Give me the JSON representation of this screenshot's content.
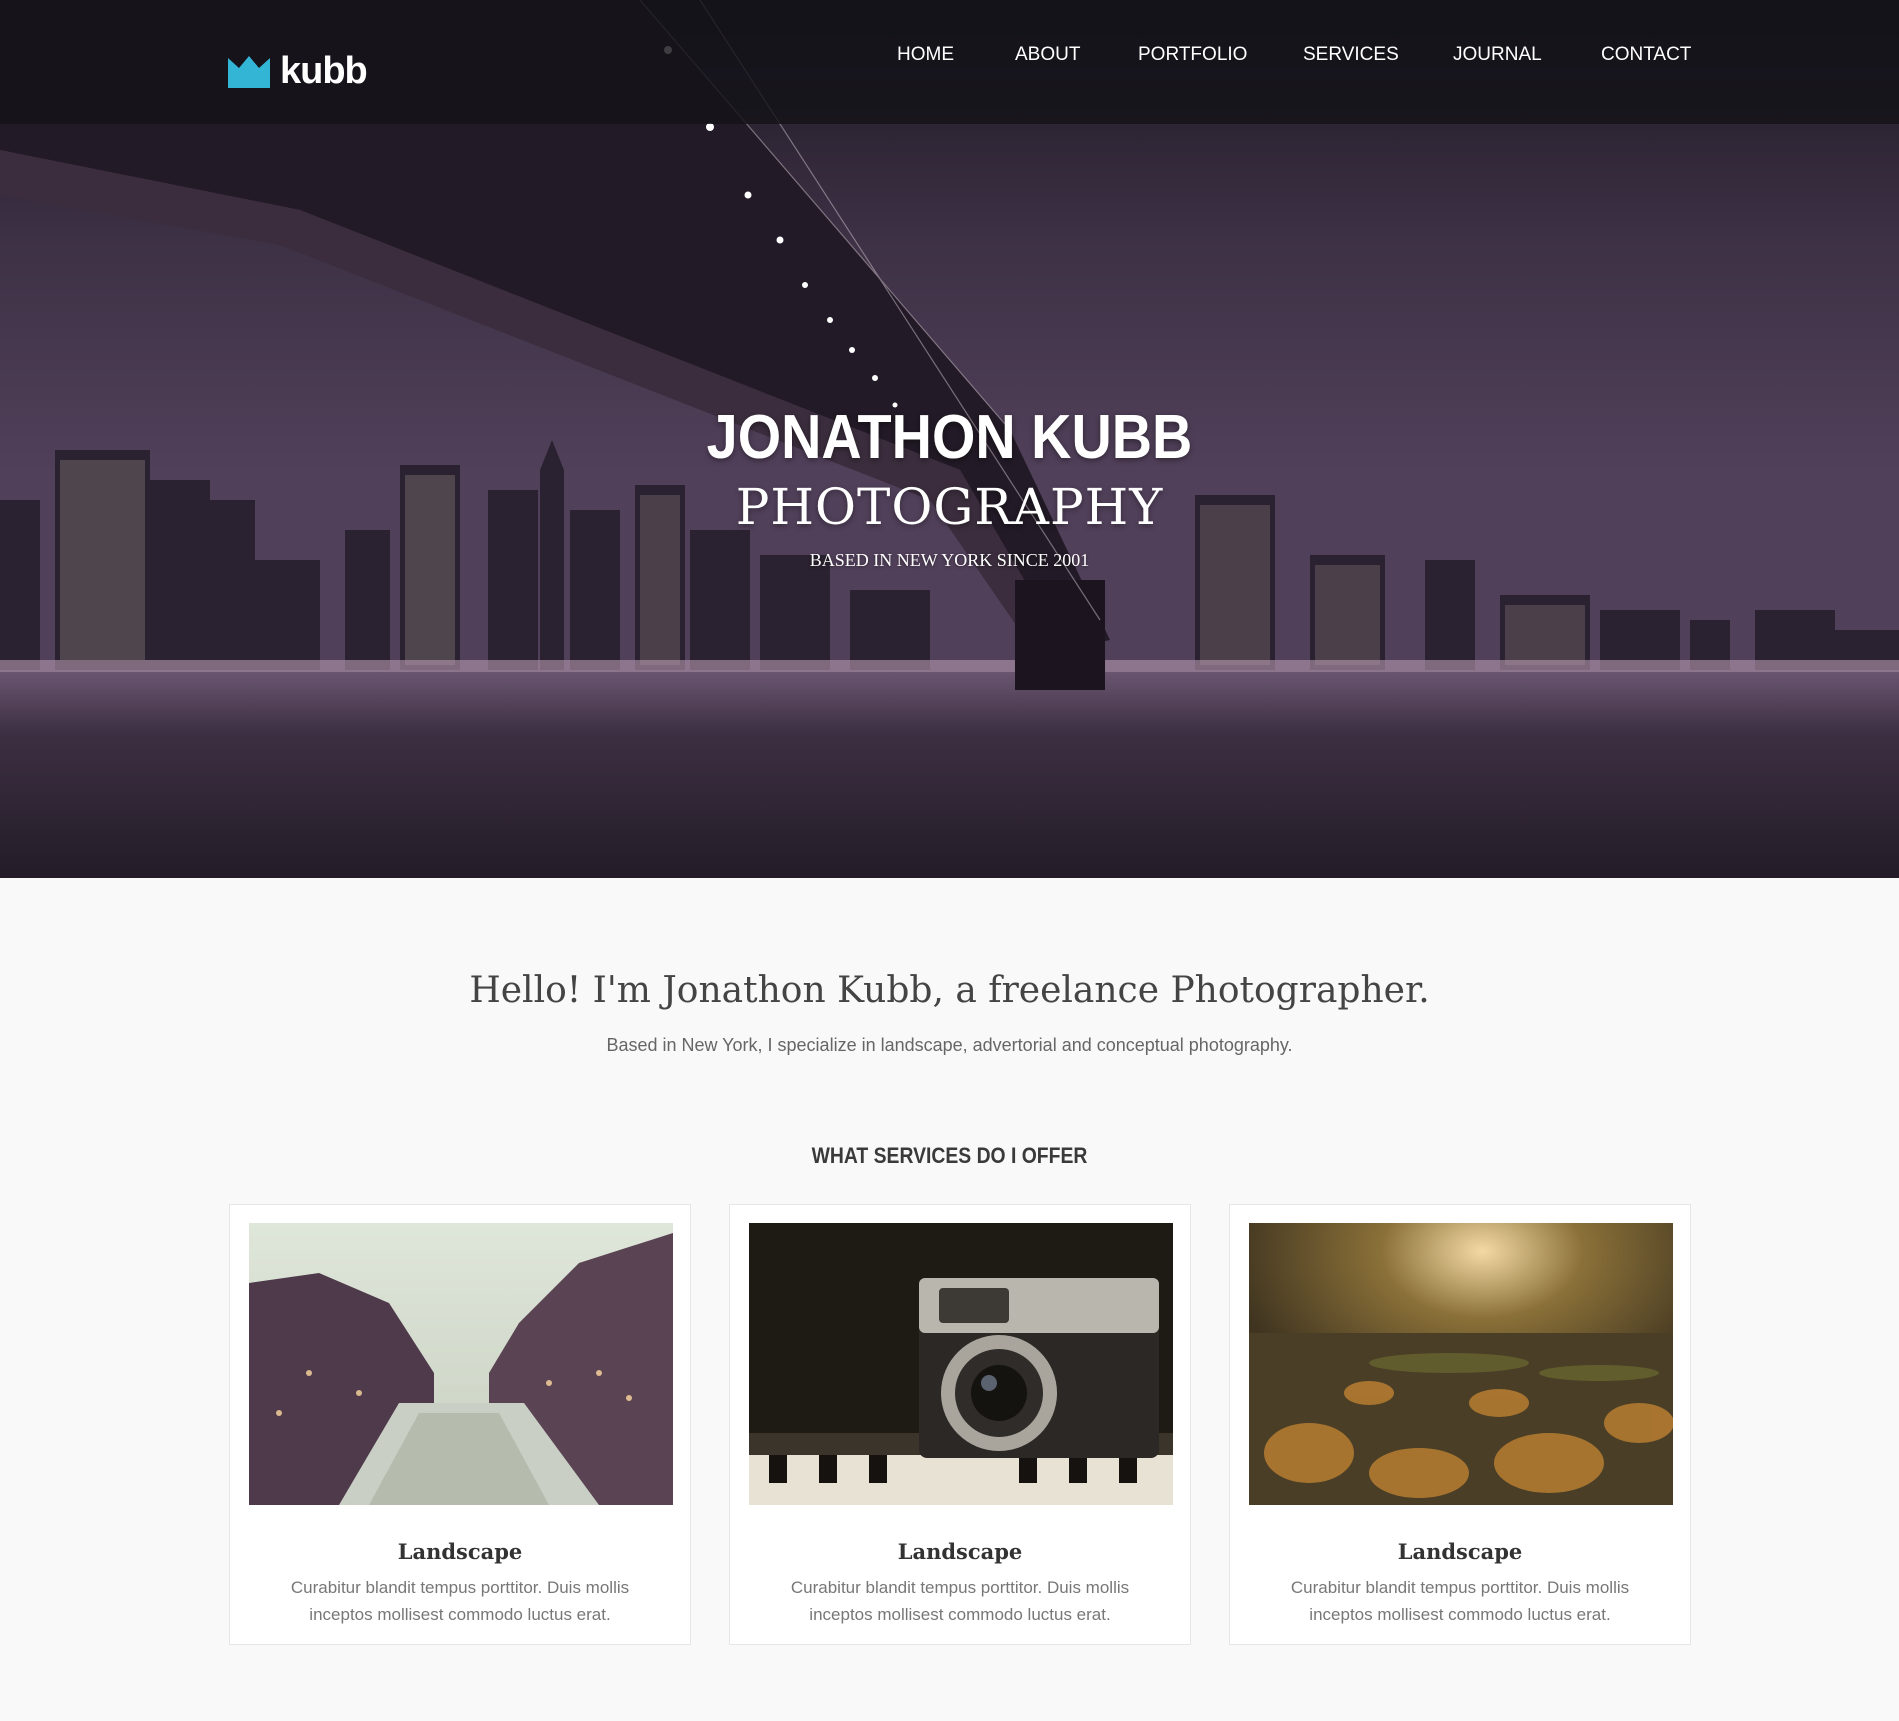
{
  "brand": {
    "name": "kubb",
    "accent_color": "#33b5d6",
    "icon": "crown-icon"
  },
  "nav": {
    "items": [
      {
        "label": "HOME"
      },
      {
        "label": "ABOUT"
      },
      {
        "label": "PORTFOLIO"
      },
      {
        "label": "SERVICES"
      },
      {
        "label": "JOURNAL"
      },
      {
        "label": "CONTACT"
      }
    ]
  },
  "hero": {
    "title": "JONATHON KUBB",
    "subtitle": "PHOTOGRAPHY",
    "tagline": "BASED IN NEW YORK SINCE 2001"
  },
  "intro": {
    "heading": "Hello! I'm Jonathon Kubb, a freelance Photographer.",
    "text": "Based in New York, I specialize in landscape, advertorial and conceptual photography."
  },
  "services": {
    "heading": "WHAT SERVICES DO I OFFER",
    "cards": [
      {
        "title": "Landscape",
        "text": "Curabitur blandit tempus porttitor. Duis mollis inceptos mollisest commodo luctus erat."
      },
      {
        "title": "Landscape",
        "text": "Curabitur blandit tempus porttitor. Duis mollis inceptos mollisest commodo luctus erat."
      },
      {
        "title": "Landscape",
        "text": "Curabitur blandit tempus porttitor. Duis mollis inceptos mollisest commodo luctus erat."
      }
    ]
  }
}
